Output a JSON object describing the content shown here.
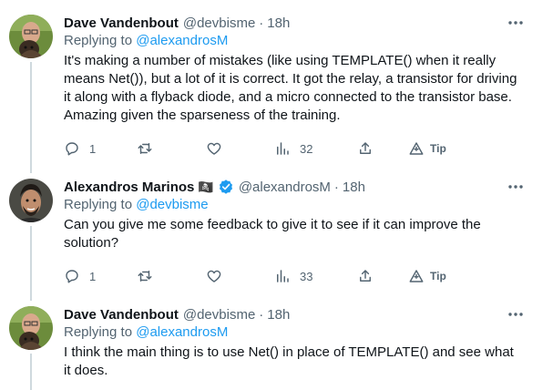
{
  "tweets": [
    {
      "name": "Dave Vandenbout",
      "handle": "@devbisme",
      "separator": "·",
      "time": "18h",
      "replying_prefix": "Replying to",
      "replying_to": "@alexandrosM",
      "text": "It's making a number of mistakes (like using TEMPLATE() when it really means Net()), but a lot of it is correct. It got the relay, a transistor for driving it along with a flyback diode, and a micro connected to the transistor base. Amazing given the sparseness of the training.",
      "replies": "1",
      "views": "32",
      "tip": "Tip"
    },
    {
      "name": "Alexandros Marinos",
      "handle": "@alexandrosM",
      "separator": "·",
      "time": "18h",
      "emoji": "🏴‍☠️",
      "replying_prefix": "Replying to",
      "replying_to": "@devbisme",
      "text": "Can you give me some feedback to give it to see if it can improve the solution?",
      "replies": "1",
      "views": "33",
      "tip": "Tip"
    },
    {
      "name": "Dave Vandenbout",
      "handle": "@devbisme",
      "separator": "·",
      "time": "18h",
      "replying_prefix": "Replying to",
      "replying_to": "@alexandrosM",
      "text": "I think the main thing is to use Net() in place of TEMPLATE() and see what it does."
    }
  ],
  "colors": {
    "text": "#0f1419",
    "muted": "#536471",
    "link": "#1d9bf0",
    "verified": "#1d9bf0",
    "thread_line": "#cfd9de"
  }
}
